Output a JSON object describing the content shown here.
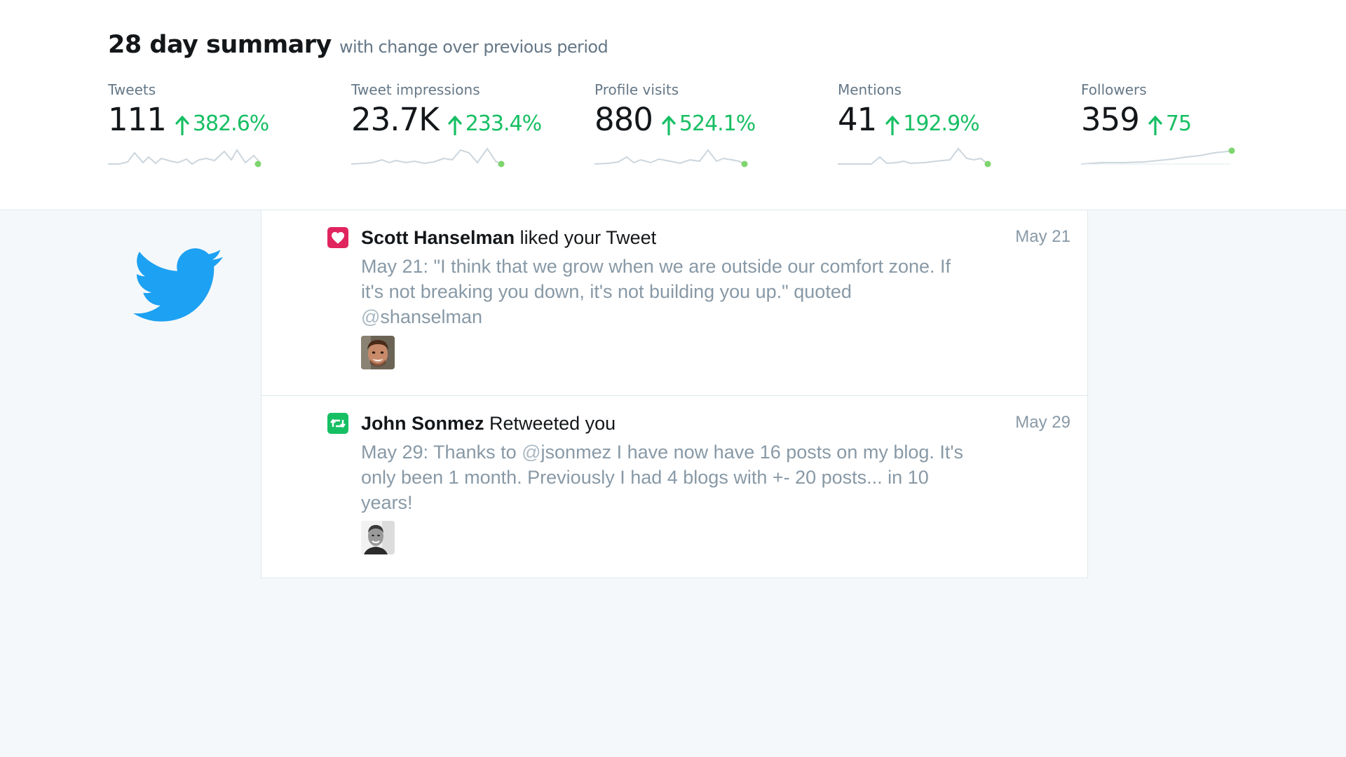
{
  "summary": {
    "title": "28 day summary",
    "subtitle": "with change over previous period",
    "metrics": [
      {
        "label": "Tweets",
        "value": "111",
        "change": "382.6%"
      },
      {
        "label": "Tweet impressions",
        "value": "23.7K",
        "change": "233.4%"
      },
      {
        "label": "Profile visits",
        "value": "880",
        "change": "524.1%"
      },
      {
        "label": "Mentions",
        "value": "41",
        "change": "192.9%"
      },
      {
        "label": "Followers",
        "value": "359",
        "change": "75"
      }
    ],
    "positive_color": "#17bf63",
    "sparkline_color": "#ccd6dd",
    "sparkline_end_color": "#7ed56f"
  },
  "brand": {
    "logo_icon": "twitter-bird-icon",
    "color": "#1da1f2"
  },
  "feed": [
    {
      "type": "like",
      "icon": "heart-icon",
      "icon_color": "#e0245e",
      "user": "Scott Hanselman",
      "action": "liked your Tweet",
      "date": "May 21",
      "text_before": "May 21: \"I think that we grow when we are outside our comfort zone. If it's not breaking you down, it's not building you up.\" quoted ",
      "mention_at": "@",
      "mention_name": "shanselman",
      "text_after": "",
      "avatar": "scott-hanselman-avatar"
    },
    {
      "type": "retweet",
      "icon": "retweet-icon",
      "icon_color": "#17bf63",
      "user": "John Sonmez",
      "action": "Retweeted you",
      "date": "May 29",
      "text_before": "May 29: Thanks to ",
      "mention_at": "@",
      "mention_name": "jsonmez",
      "text_after": " I have now have 16 posts on my blog. It's only been 1 month. Previously I had 4 blogs with +- 20 posts... in 10 years!",
      "avatar": "john-sonmez-avatar"
    }
  ]
}
